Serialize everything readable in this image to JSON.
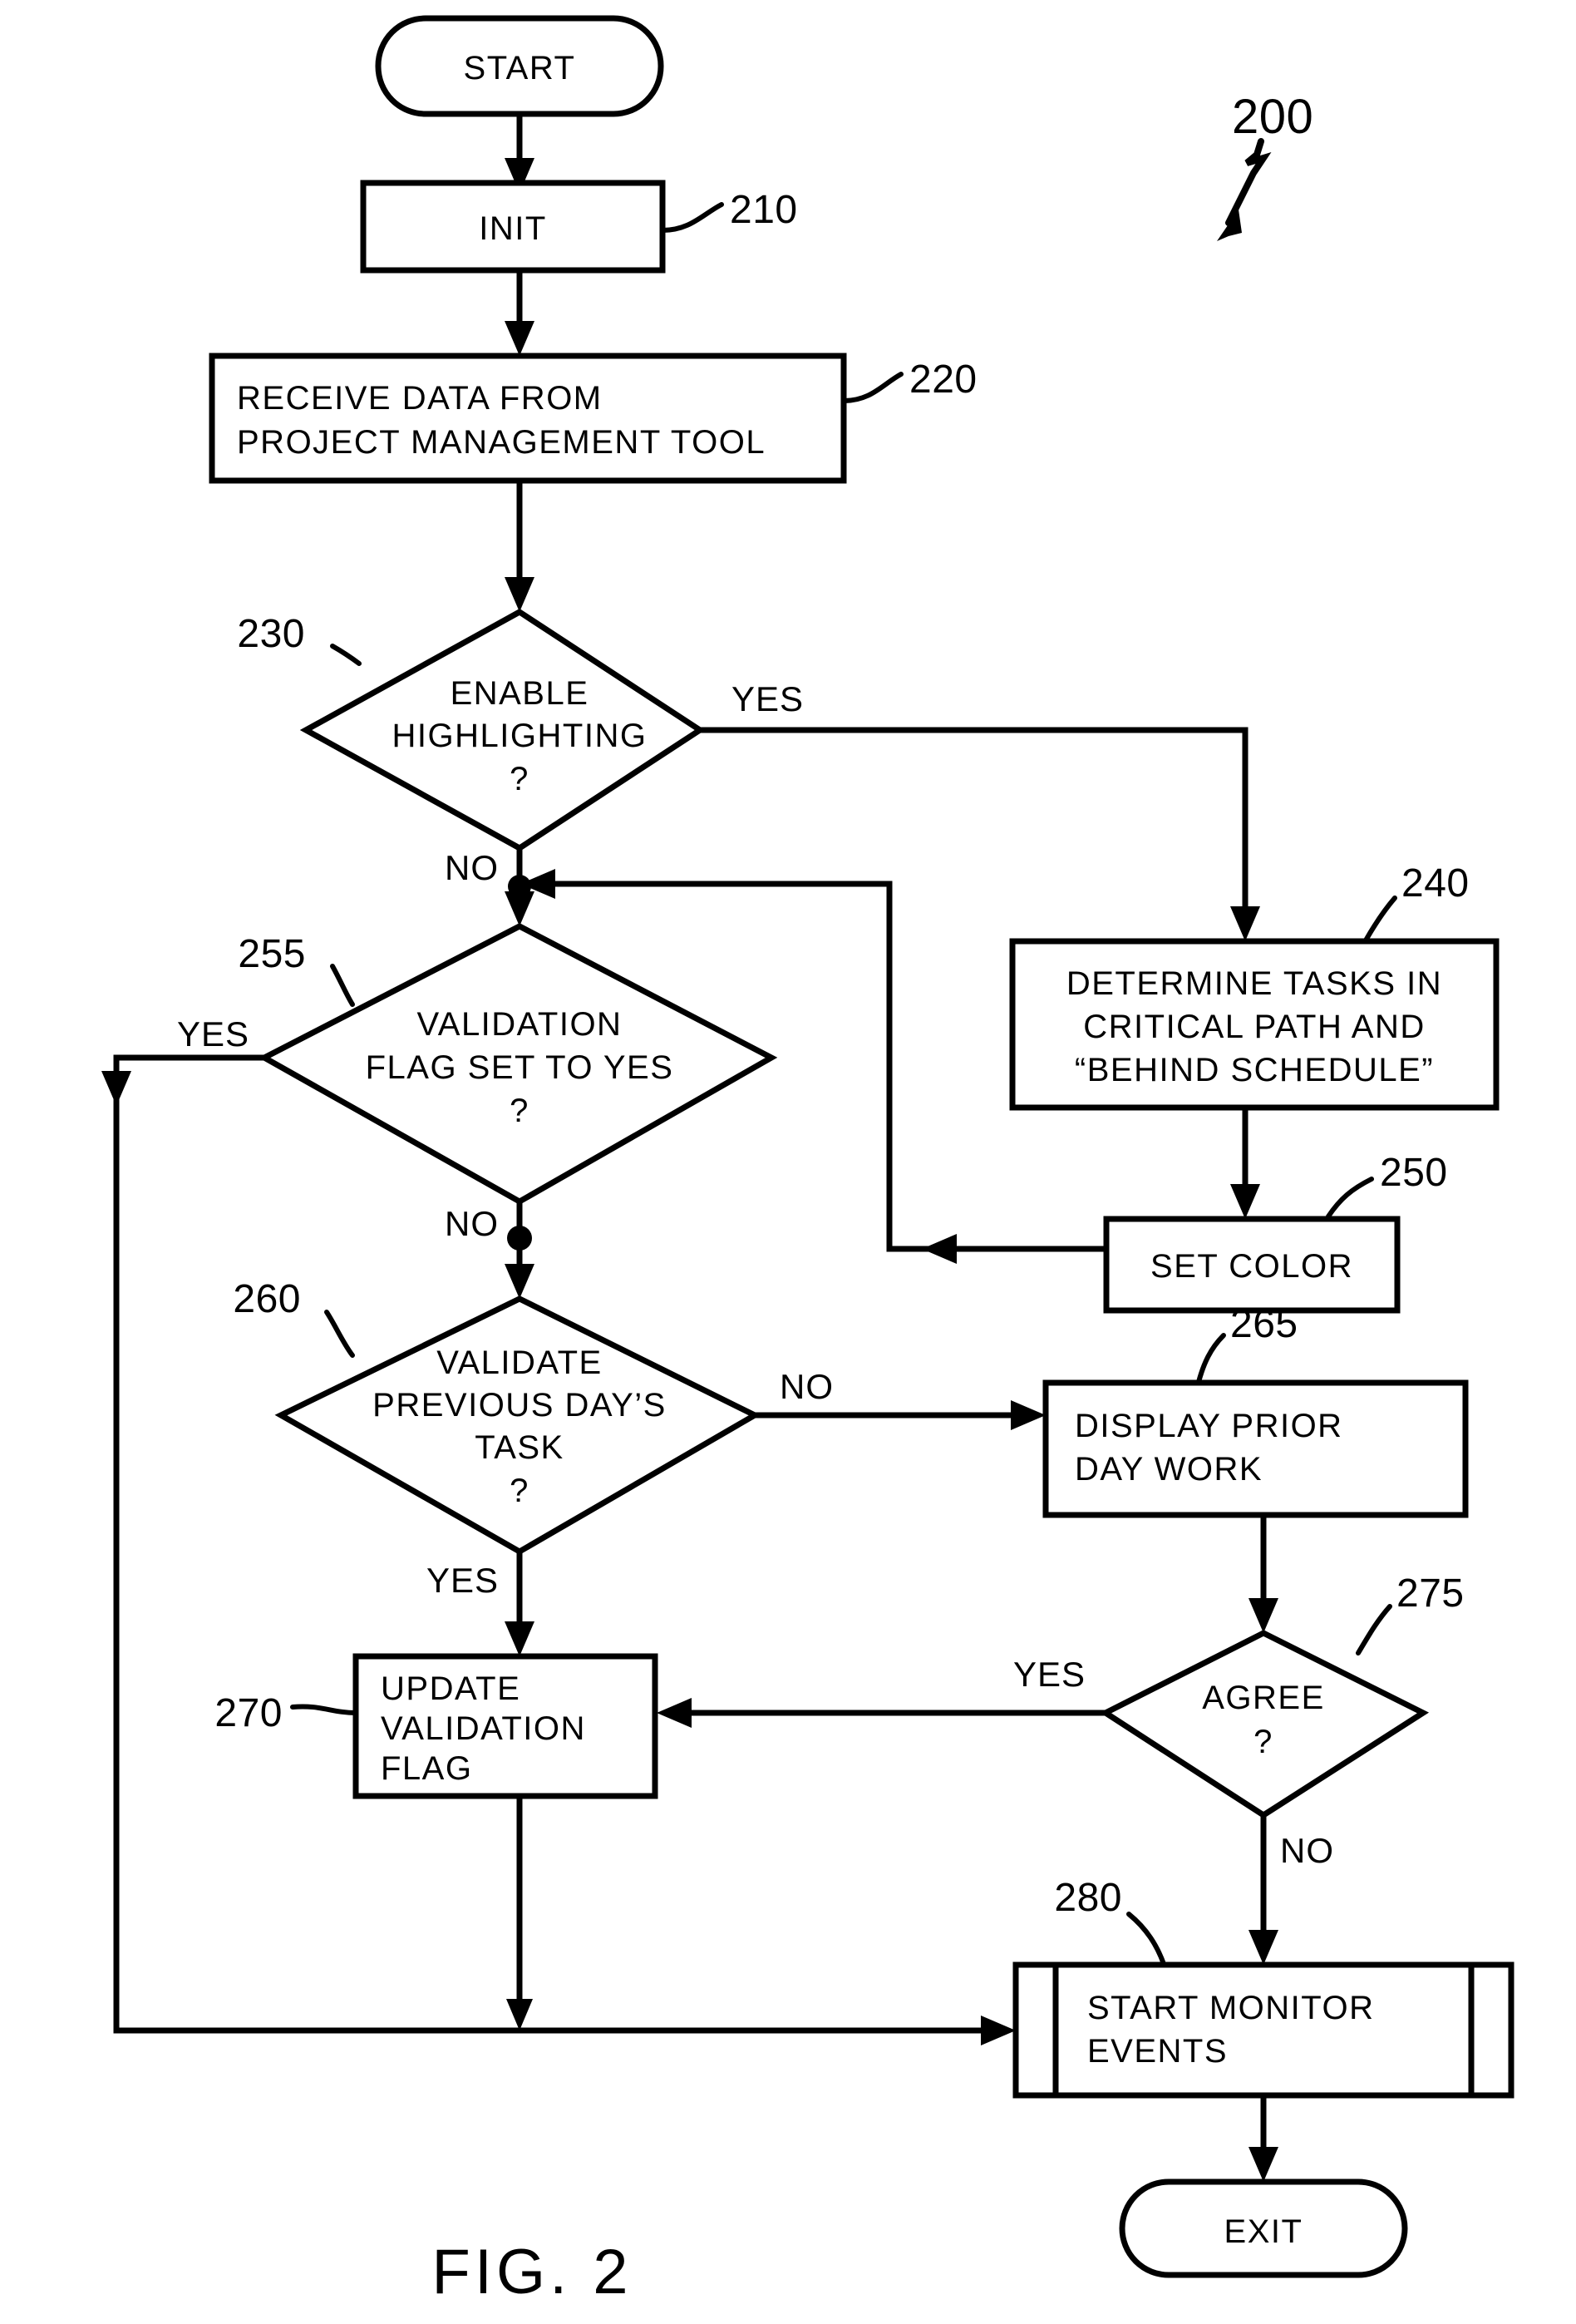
{
  "figure": {
    "caption": "FIG. 2",
    "diagram_ref": "200",
    "type": "flowchart"
  },
  "nodes": {
    "start": {
      "label": "START",
      "shape": "terminator"
    },
    "init": {
      "label": "INIT",
      "ref": "210",
      "shape": "process"
    },
    "receive": {
      "line1": "RECEIVE DATA FROM",
      "line2": "PROJECT MANAGEMENT TOOL",
      "ref": "220",
      "shape": "process"
    },
    "enable_highlighting": {
      "line1": "ENABLE",
      "line2": "HIGHLIGHTING",
      "line3": "?",
      "ref": "230",
      "shape": "decision"
    },
    "determine_tasks": {
      "line1": "DETERMINE TASKS IN",
      "line2": "CRITICAL PATH AND",
      "line3": "“BEHIND SCHEDULE”",
      "ref": "240",
      "shape": "process"
    },
    "set_color": {
      "label": "SET COLOR",
      "ref": "250",
      "shape": "process"
    },
    "validation_flag": {
      "line1": "VALIDATION",
      "line2": "FLAG SET TO YES",
      "line3": "?",
      "ref": "255",
      "shape": "decision"
    },
    "validate_prev_day": {
      "line1": "VALIDATE",
      "line2": "PREVIOUS DAY’S",
      "line3": "TASK",
      "line4": "?",
      "ref": "260",
      "shape": "decision"
    },
    "display_prior": {
      "line1": "DISPLAY PRIOR",
      "line2": "DAY WORK",
      "ref": "265",
      "shape": "process"
    },
    "update_flag": {
      "line1": "UPDATE",
      "line2": "VALIDATION",
      "line3": "FLAG",
      "ref": "270",
      "shape": "process"
    },
    "agree": {
      "line1": "AGREE",
      "line2": "?",
      "ref": "275",
      "shape": "decision"
    },
    "start_monitor": {
      "line1": "START MONITOR",
      "line2": "EVENTS",
      "ref": "280",
      "shape": "predefined-process"
    },
    "exit": {
      "label": "EXIT",
      "shape": "terminator"
    }
  },
  "branch_labels": {
    "enable_yes": "YES",
    "enable_no": "NO",
    "valflag_yes": "YES",
    "valflag_no": "NO",
    "validate_no": "NO",
    "validate_yes": "YES",
    "agree_yes": "YES",
    "agree_no": "NO"
  },
  "colors": {
    "ink": "#000000",
    "paper": "#ffffff"
  }
}
